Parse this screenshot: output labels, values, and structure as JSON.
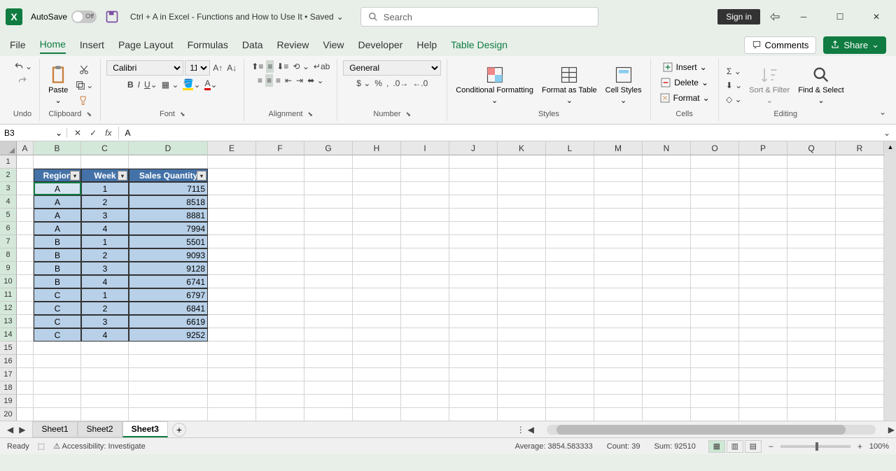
{
  "titlebar": {
    "autosave_label": "AutoSave",
    "autosave_state": "Off",
    "document_title": "Ctrl + A in Excel - Functions and How to Use It • Saved",
    "search_placeholder": "Search",
    "signin": "Sign in"
  },
  "tabs": {
    "file": "File",
    "home": "Home",
    "insert": "Insert",
    "page_layout": "Page Layout",
    "formulas": "Formulas",
    "data": "Data",
    "review": "Review",
    "view": "View",
    "developer": "Developer",
    "help": "Help",
    "table_design": "Table Design",
    "comments": "Comments",
    "share": "Share"
  },
  "ribbon": {
    "undo": "Undo",
    "clipboard": "Clipboard",
    "paste": "Paste",
    "font_group": "Font",
    "font_name": "Calibri",
    "font_size": "11",
    "alignment": "Alignment",
    "number": "Number",
    "number_format": "General",
    "styles": "Styles",
    "cond_fmt": "Conditional Formatting",
    "fmt_table": "Format as Table",
    "cell_styles": "Cell Styles",
    "cells": "Cells",
    "insert_cell": "Insert",
    "delete_cell": "Delete",
    "format_cell": "Format",
    "editing": "Editing",
    "sort_filter": "Sort & Filter",
    "find_select": "Find & Select"
  },
  "formulabar": {
    "namebox": "B3",
    "formula": "A"
  },
  "columns": [
    "A",
    "B",
    "C",
    "D",
    "E",
    "F",
    "G",
    "H",
    "I",
    "J",
    "K",
    "L",
    "M",
    "N",
    "O",
    "P",
    "Q",
    "R"
  ],
  "col_widths": {
    "A": 24,
    "B": 68,
    "C": 68,
    "D": 113,
    "default": 69
  },
  "rows_visible": 20,
  "table": {
    "headers": [
      "Region",
      "Week",
      "Sales Quantity"
    ],
    "data": [
      [
        "A",
        "1",
        "7115"
      ],
      [
        "A",
        "2",
        "8518"
      ],
      [
        "A",
        "3",
        "8881"
      ],
      [
        "A",
        "4",
        "7994"
      ],
      [
        "B",
        "1",
        "5501"
      ],
      [
        "B",
        "2",
        "9093"
      ],
      [
        "B",
        "3",
        "9128"
      ],
      [
        "B",
        "4",
        "6741"
      ],
      [
        "C",
        "1",
        "6797"
      ],
      [
        "C",
        "2",
        "6841"
      ],
      [
        "C",
        "3",
        "6619"
      ],
      [
        "C",
        "4",
        "9252"
      ]
    ]
  },
  "active_cell": "B3",
  "selection": {
    "from_row": 3,
    "to_row": 14,
    "from_col": "B",
    "to_col": "D"
  },
  "sheets": {
    "list": [
      "Sheet1",
      "Sheet2",
      "Sheet3"
    ],
    "active": "Sheet3"
  },
  "statusbar": {
    "ready": "Ready",
    "accessibility": "Accessibility: Investigate",
    "average_label": "Average:",
    "average_value": "3854.583333",
    "count_label": "Count:",
    "count_value": "39",
    "sum_label": "Sum:",
    "sum_value": "92510",
    "zoom": "100%"
  }
}
